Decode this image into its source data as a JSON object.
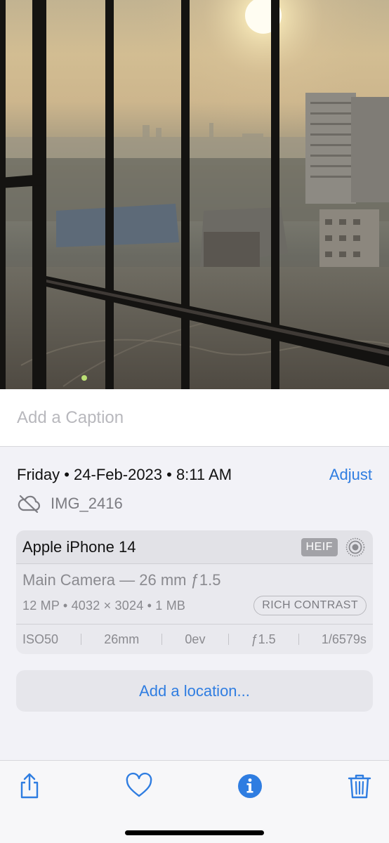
{
  "caption": {
    "placeholder": "Add a Caption"
  },
  "info": {
    "date_line": "Friday • 24-Feb-2023 • 8:11 AM",
    "adjust_label": "Adjust",
    "file_name": "IMG_2416",
    "cloud_icon": "cloud-slash-icon"
  },
  "camera": {
    "device": "Apple iPhone 14",
    "format_badge": "HEIF",
    "live_icon": "live-photo-icon",
    "lens": "Main Camera — 26 mm ƒ1.5",
    "specs": "12 MP • 4032 × 3024 • 1 MB",
    "style_badge": "RICH CONTRAST",
    "exif": [
      "ISO50",
      "26mm",
      "0ev",
      "ƒ1.5",
      "1/6579s"
    ]
  },
  "location": {
    "label": "Add a location..."
  },
  "toolbar": {
    "items": [
      "share-icon",
      "heart-icon",
      "info-icon",
      "trash-icon"
    ],
    "accent_color": "#2f7de1"
  }
}
